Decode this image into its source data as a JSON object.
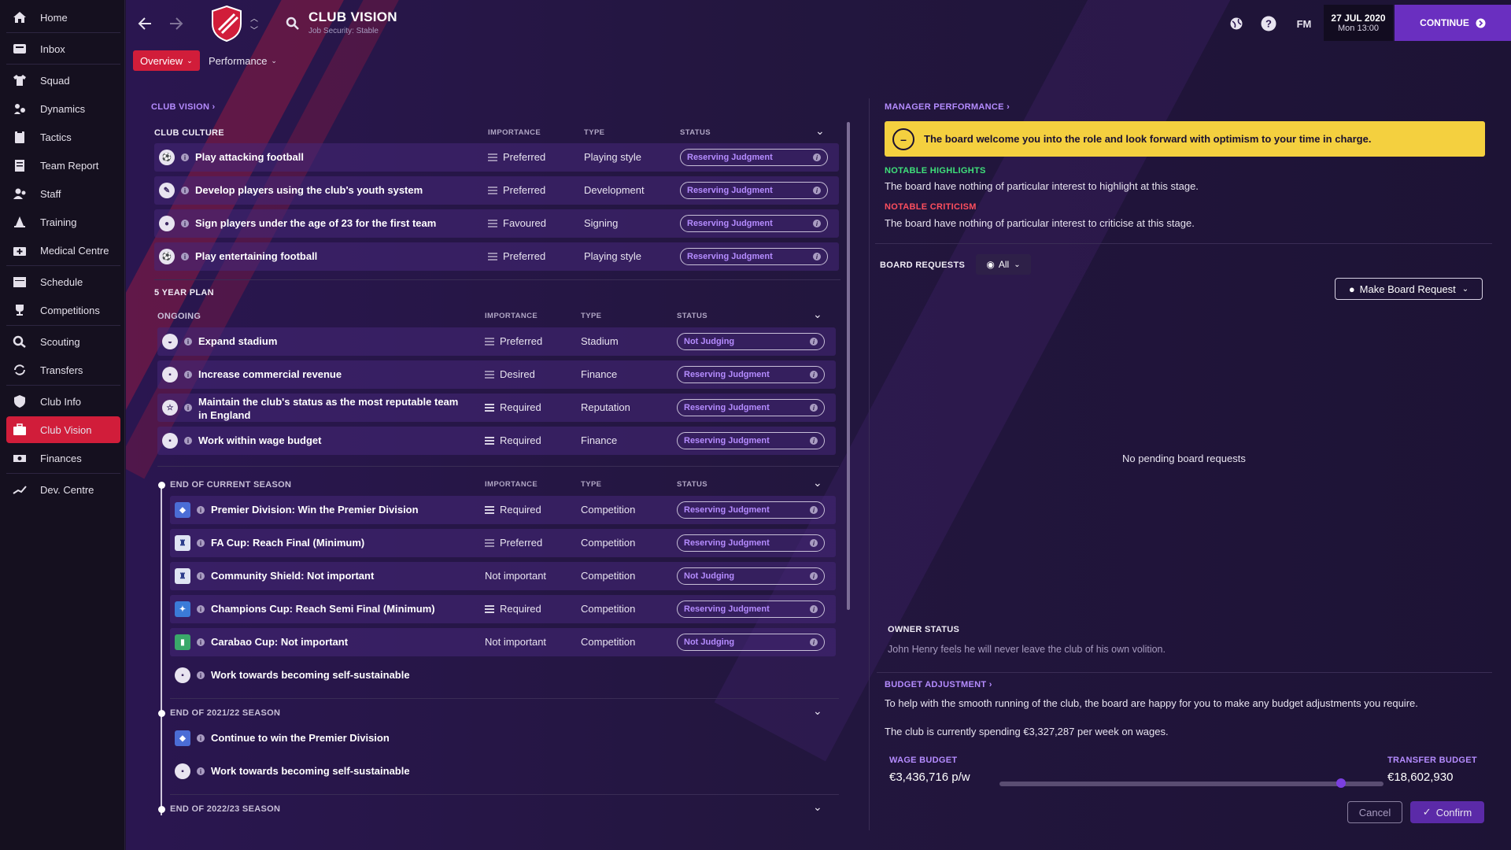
{
  "sidebar": {
    "items": [
      {
        "label": "Home",
        "icon": "home-icon"
      },
      {
        "label": "Inbox",
        "icon": "inbox-icon"
      },
      {
        "label": "Squad",
        "icon": "shirt-icon"
      },
      {
        "label": "Dynamics",
        "icon": "dynamics-icon"
      },
      {
        "label": "Tactics",
        "icon": "clipboard-icon"
      },
      {
        "label": "Team Report",
        "icon": "report-icon"
      },
      {
        "label": "Staff",
        "icon": "staff-icon"
      },
      {
        "label": "Training",
        "icon": "cone-icon"
      },
      {
        "label": "Medical Centre",
        "icon": "medical-icon"
      },
      {
        "label": "Schedule",
        "icon": "calendar-icon"
      },
      {
        "label": "Competitions",
        "icon": "trophy-icon"
      },
      {
        "label": "Scouting",
        "icon": "search-icon"
      },
      {
        "label": "Transfers",
        "icon": "transfer-icon"
      },
      {
        "label": "Club Info",
        "icon": "shield-icon"
      },
      {
        "label": "Club Vision",
        "icon": "briefcase-icon"
      },
      {
        "label": "Finances",
        "icon": "money-icon"
      },
      {
        "label": "Dev. Centre",
        "icon": "growth-icon"
      }
    ]
  },
  "header": {
    "title": "CLUB VISION",
    "subtitle": "Job Security: Stable",
    "tabs": [
      "Overview",
      "Performance"
    ],
    "fm_label": "FM",
    "date": "27 JUL 2020",
    "time": "Mon 13:00",
    "continue_label": "CONTINUE"
  },
  "club_vision": {
    "link_label": "CLUB VISION",
    "columns": {
      "importance": "IMPORTANCE",
      "type": "TYPE",
      "status": "STATUS"
    },
    "culture_heading": "CLUB CULTURE",
    "culture_rows": [
      {
        "text": "Play attacking football",
        "importance": "Preferred",
        "type": "Playing style",
        "status": "Reserving Judgment"
      },
      {
        "text": "Develop players using the club's youth system",
        "importance": "Preferred",
        "type": "Development",
        "status": "Reserving Judgment"
      },
      {
        "text": "Sign players under the age of 23 for the first team",
        "importance": "Favoured",
        "type": "Signing",
        "status": "Reserving Judgment"
      },
      {
        "text": "Play entertaining football",
        "importance": "Preferred",
        "type": "Playing style",
        "status": "Reserving Judgment"
      }
    ],
    "plan_heading": "5 YEAR PLAN",
    "ongoing_heading": "ONGOING",
    "ongoing_rows": [
      {
        "text": "Expand stadium",
        "importance": "Preferred",
        "type": "Stadium",
        "status": "Not Judging"
      },
      {
        "text": "Increase commercial revenue",
        "importance": "Desired",
        "type": "Finance",
        "status": "Reserving Judgment"
      },
      {
        "text": "Maintain the club's status as the most reputable team",
        "text2": "in England",
        "importance": "Required",
        "type": "Reputation",
        "status": "Reserving Judgment"
      },
      {
        "text": "Work within wage budget",
        "importance": "Required",
        "type": "Finance",
        "status": "Reserving Judgment"
      }
    ],
    "season_heading": "END OF CURRENT SEASON",
    "season_rows": [
      {
        "text": "Premier Division: Win the Premier Division",
        "importance": "Required",
        "type": "Competition",
        "status": "Reserving Judgment"
      },
      {
        "text": "FA Cup: Reach Final (Minimum)",
        "importance": "Preferred",
        "type": "Competition",
        "status": "Reserving Judgment"
      },
      {
        "text": "Community Shield: Not important",
        "importance": "Not important",
        "type": "Competition",
        "status": "Not Judging"
      },
      {
        "text": "Champions Cup: Reach Semi Final (Minimum)",
        "importance": "Required",
        "type": "Competition",
        "status": "Reserving Judgment"
      },
      {
        "text": "Carabao Cup: Not important",
        "importance": "Not important",
        "type": "Competition",
        "status": "Not Judging"
      },
      {
        "text": "Work towards becoming self-sustainable"
      }
    ],
    "season2_heading": "END OF 2021/22 SEASON",
    "season2_rows": [
      {
        "text": "Continue to win the Premier Division"
      },
      {
        "text": "Work towards becoming self-sustainable"
      }
    ],
    "season3_heading": "END OF 2022/23 SEASON"
  },
  "manager": {
    "link_label": "MANAGER PERFORMANCE",
    "banner": "The board welcome you into the role and look forward with optimism to your time in charge.",
    "highlights_heading": "NOTABLE HIGHLIGHTS",
    "highlights_text": "The board have nothing of particular interest to highlight at this stage.",
    "criticism_heading": "NOTABLE CRITICISM",
    "criticism_text": "The board have nothing of particular interest to criticise at this stage."
  },
  "board_requests": {
    "heading": "BOARD REQUESTS",
    "filter": "All",
    "make_request": "Make Board Request",
    "empty": "No pending board requests"
  },
  "owner": {
    "heading": "OWNER STATUS",
    "text": "John Henry feels he will never leave the club of his own volition."
  },
  "budget": {
    "link_label": "BUDGET ADJUSTMENT",
    "text1": "To help with the smooth running of the club, the board are happy for you to make any budget adjustments you require.",
    "text2": "The club is currently spending €3,327,287 per week on wages.",
    "wage_label": "WAGE BUDGET",
    "wage_value": "€3,436,716 p/w",
    "transfer_label": "TRANSFER BUDGET",
    "transfer_value": "€18,602,930",
    "slider_fraction": 0.89,
    "cancel": "Cancel",
    "confirm": "Confirm"
  }
}
